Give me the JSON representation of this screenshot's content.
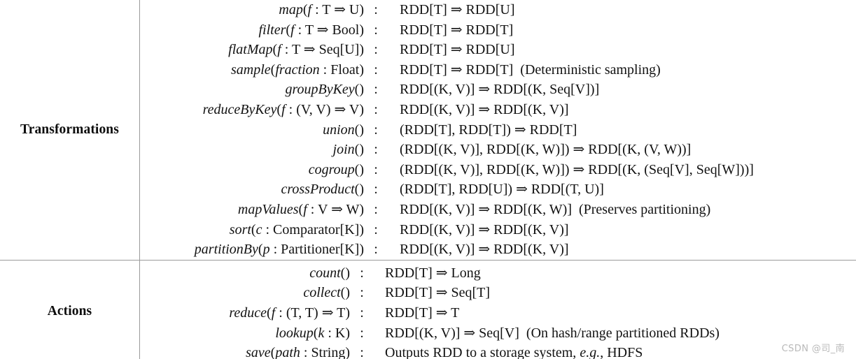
{
  "table": {
    "sections": [
      {
        "id": "transformations",
        "label": "Transformations",
        "rows": [
          {
            "signature": "map(f : T ⇒ U)",
            "colon": ":",
            "type": "RDD[T] ⇒ RDD[U]"
          },
          {
            "signature": "filter(f : T ⇒ Bool)",
            "colon": ":",
            "type": "RDD[T] ⇒ RDD[T]"
          },
          {
            "signature": "flatMap(f : T ⇒ Seq[U])",
            "colon": ":",
            "type": "RDD[T] ⇒ RDD[U]"
          },
          {
            "signature": "sample(fraction : Float)",
            "colon": ":",
            "type": "RDD[T] ⇒ RDD[T]",
            "note": "(Deterministic sampling)"
          },
          {
            "signature": "groupByKey()",
            "colon": ":",
            "type": "RDD[(K, V)] ⇒ RDD[(K, Seq[V])]"
          },
          {
            "signature": "reduceByKey(f : (V, V) ⇒ V)",
            "colon": ":",
            "type": "RDD[(K, V)] ⇒ RDD[(K, V)]"
          },
          {
            "signature": "union()",
            "colon": ":",
            "type": "(RDD[T], RDD[T]) ⇒ RDD[T]"
          },
          {
            "signature": "join()",
            "colon": ":",
            "type": "(RDD[(K, V)], RDD[(K, W)]) ⇒ RDD[(K, (V, W))]"
          },
          {
            "signature": "cogroup()",
            "colon": ":",
            "type": "(RDD[(K, V)], RDD[(K, W)]) ⇒ RDD[(K, (Seq[V], Seq[W]))]"
          },
          {
            "signature": "crossProduct()",
            "colon": ":",
            "type": "(RDD[T], RDD[U]) ⇒ RDD[(T, U)]"
          },
          {
            "signature": "mapValues(f : V ⇒ W)",
            "colon": ":",
            "type": "RDD[(K, V)] ⇒ RDD[(K, W)]",
            "note": "(Preserves partitioning)"
          },
          {
            "signature": "sort(c : Comparator[K])",
            "colon": ":",
            "type": "RDD[(K, V)] ⇒ RDD[(K, V)]"
          },
          {
            "signature": "partitionBy(p : Partitioner[K])",
            "colon": ":",
            "type": "RDD[(K, V)] ⇒ RDD[(K, V)]"
          }
        ]
      },
      {
        "id": "actions",
        "label": "Actions",
        "rows": [
          {
            "signature": "count()",
            "colon": ":",
            "type": "RDD[T] ⇒ Long"
          },
          {
            "signature": "collect()",
            "colon": ":",
            "type": "RDD[T] ⇒ Seq[T]"
          },
          {
            "signature": "reduce(f : (T, T) ⇒ T)",
            "colon": ":",
            "type": "RDD[T] ⇒ T"
          },
          {
            "signature": "lookup(k : K)",
            "colon": ":",
            "type": "RDD[(K, V)] ⇒ Seq[V]",
            "note": "(On hash/range partitioned RDDs)"
          },
          {
            "signature": "save(path : String)",
            "colon": ":",
            "type": "Outputs RDD to a storage system, e.g., HDFS"
          }
        ]
      }
    ]
  },
  "watermark": {
    "text": "CSDN @司_南"
  },
  "colors": {
    "rule": "#9a9a9a",
    "text": "#121212",
    "watermark": "#b9b9b9",
    "background": "#ffffff"
  }
}
